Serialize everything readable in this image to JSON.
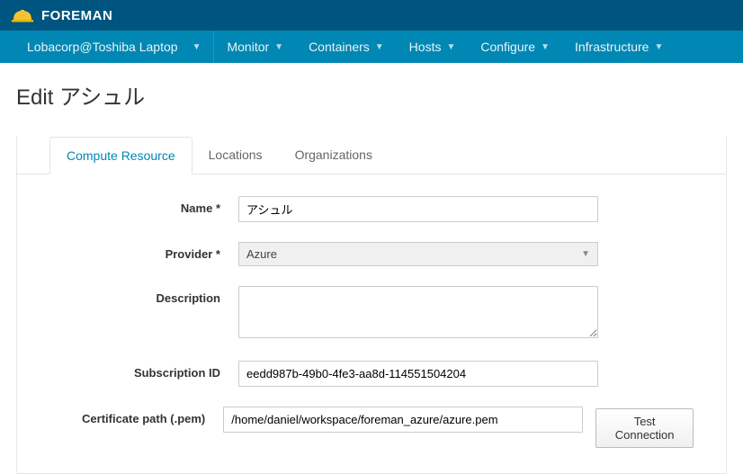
{
  "brand": "FOREMAN",
  "context_switcher": {
    "label": "Lobacorp@Toshiba Laptop"
  },
  "nav": {
    "monitor": "Monitor",
    "containers": "Containers",
    "hosts": "Hosts",
    "configure": "Configure",
    "infrastructure": "Infrastructure"
  },
  "page_title": "Edit アシュル",
  "tabs": {
    "compute_resource": "Compute Resource",
    "locations": "Locations",
    "organizations": "Organizations"
  },
  "form": {
    "name_label": "Name *",
    "name_value": "アシュル",
    "provider_label": "Provider *",
    "provider_value": "Azure",
    "description_label": "Description",
    "description_value": "",
    "subscription_label": "Subscription ID",
    "subscription_value": "eedd987b-49b0-4fe3-aa8d-114551504204",
    "cert_label": "Certificate path (.pem)",
    "cert_value": "/home/daniel/workspace/foreman_azure/azure.pem",
    "test_connection_label": "Test Connection"
  }
}
